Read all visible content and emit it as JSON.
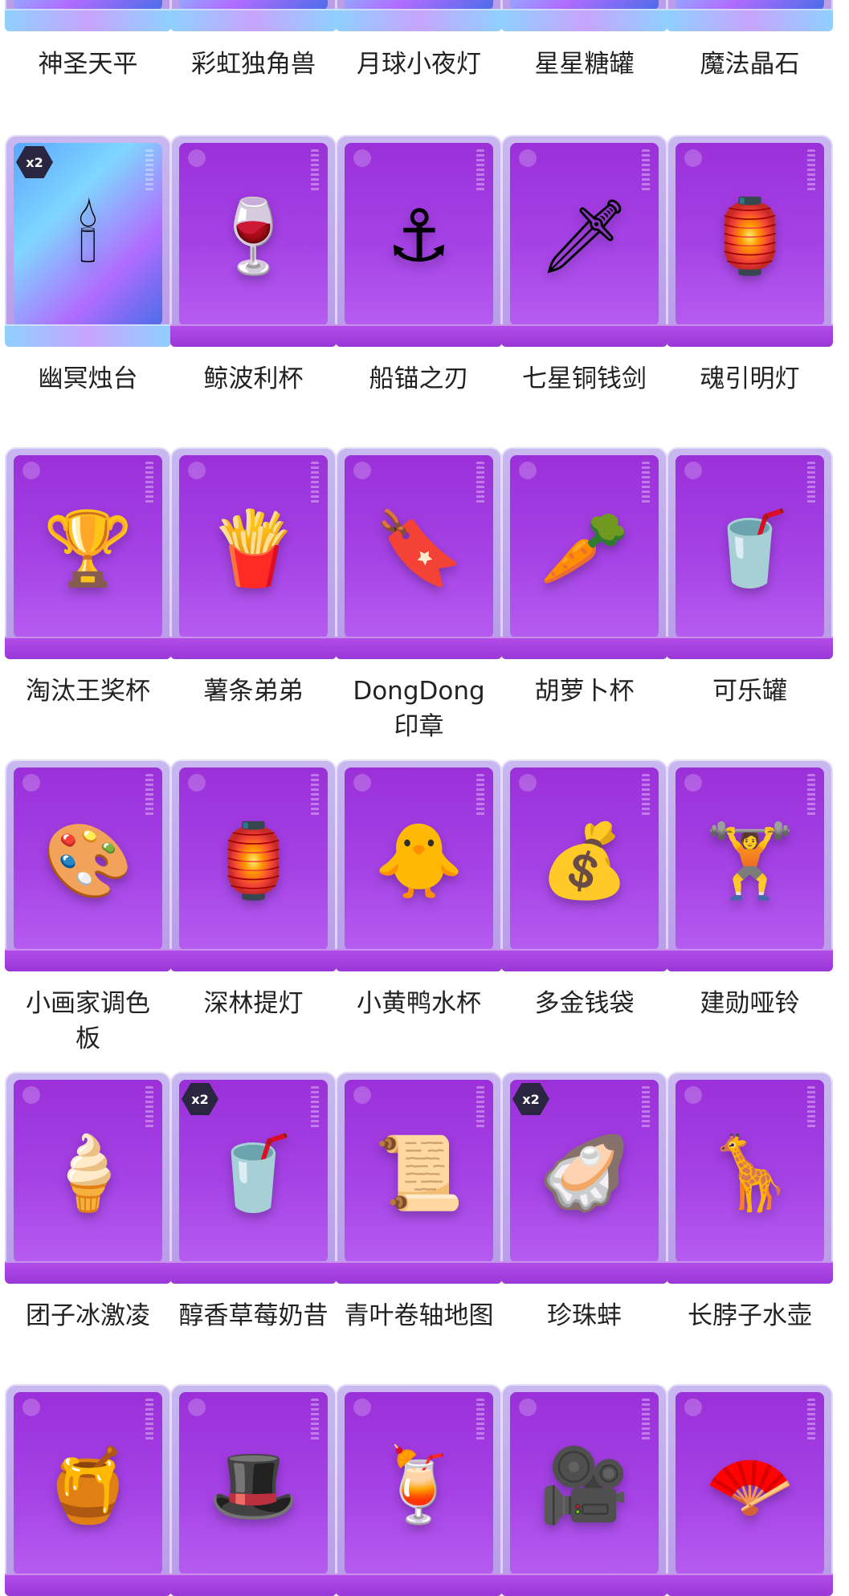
{
  "rows": [
    {
      "partial": true,
      "items": [
        {
          "name": "神圣天平",
          "special": true,
          "icon": "scales"
        },
        {
          "name": "彩虹独角兽",
          "special": true,
          "icon": "unicorn"
        },
        {
          "name": "月球小夜灯",
          "special": true,
          "icon": "moon-lamp"
        },
        {
          "name": "星星糖罐",
          "special": true,
          "icon": "candy-jar"
        },
        {
          "name": "魔法晶石",
          "special": true,
          "icon": "crystal"
        }
      ]
    },
    {
      "items": [
        {
          "name": "幽冥烛台",
          "special": true,
          "badge": "x2",
          "icon": "candelabra"
        },
        {
          "name": "鲸波利杯",
          "icon": "orca-goblet"
        },
        {
          "name": "船锚之刃",
          "icon": "anchor"
        },
        {
          "name": "七星铜钱剑",
          "icon": "coin-sword"
        },
        {
          "name": "魂引明灯",
          "icon": "lantern"
        }
      ]
    },
    {
      "items": [
        {
          "name": "淘汰王奖杯",
          "icon": "fish-trophy"
        },
        {
          "name": "薯条弟弟",
          "icon": "fries"
        },
        {
          "name": "DongDong印章",
          "icon": "stamp"
        },
        {
          "name": "胡萝卜杯",
          "icon": "carrot-cup"
        },
        {
          "name": "可乐罐",
          "icon": "cola-bottle"
        }
      ]
    },
    {
      "items": [
        {
          "name": "小画家调色板",
          "icon": "palette"
        },
        {
          "name": "深林提灯",
          "icon": "green-lantern"
        },
        {
          "name": "小黄鸭水杯",
          "icon": "duck-cup"
        },
        {
          "name": "多金钱袋",
          "icon": "money-bag"
        },
        {
          "name": "建勋哑铃",
          "icon": "dumbbell"
        }
      ]
    },
    {
      "items": [
        {
          "name": "团子冰激凌",
          "icon": "ice-cream"
        },
        {
          "name": "醇香草莓奶昔",
          "badge": "x2",
          "icon": "milkshake"
        },
        {
          "name": "青叶卷轴地图",
          "icon": "scroll-map"
        },
        {
          "name": "珍珠蚌",
          "badge": "x2",
          "icon": "pearl-clam"
        },
        {
          "name": "长脖子水壶",
          "icon": "giraffe-flask"
        }
      ]
    },
    {
      "partial": true,
      "items": [
        {
          "name": "",
          "icon": "honey-pot"
        },
        {
          "name": "",
          "icon": "jester-hat"
        },
        {
          "name": "",
          "icon": "cocktail"
        },
        {
          "name": "",
          "icon": "film-camera"
        },
        {
          "name": "",
          "icon": "fan"
        }
      ]
    }
  ]
}
